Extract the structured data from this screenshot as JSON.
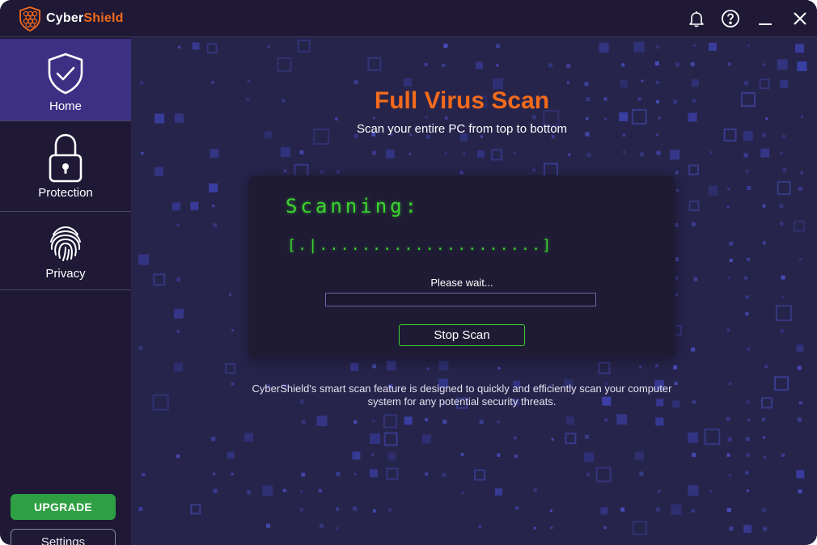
{
  "app": {
    "brand_part1": "Cyber",
    "brand_part2": "Shield",
    "logo_icon": "shield-hex-logo-icon",
    "accent_color": "#f26a1b",
    "green_color": "#3bd42e"
  },
  "titlebar": {
    "icons": [
      "bell-icon",
      "help-icon",
      "minimize-icon",
      "close-icon"
    ]
  },
  "sidebar": {
    "items": [
      {
        "label": "Home",
        "icon": "shield-check-icon",
        "active": true
      },
      {
        "label": "Protection",
        "icon": "lock-icon",
        "active": false
      },
      {
        "label": "Privacy",
        "icon": "fingerprint-icon",
        "active": false
      }
    ],
    "upgrade_label": "UPGRADE",
    "settings_label": "Settings"
  },
  "main": {
    "title": "Full Virus Scan",
    "subtitle": "Scan your entire PC from top to bottom",
    "scan": {
      "status_text": "Scanning:",
      "ascii_progress": "[.|.....................]",
      "wait_text": "Please wait...",
      "progress_fraction": 0.0,
      "stop_label": "Stop Scan"
    },
    "description": "CyberShield's smart scan feature is designed to quickly and efficiently scan your computer system for any potential security threats."
  }
}
